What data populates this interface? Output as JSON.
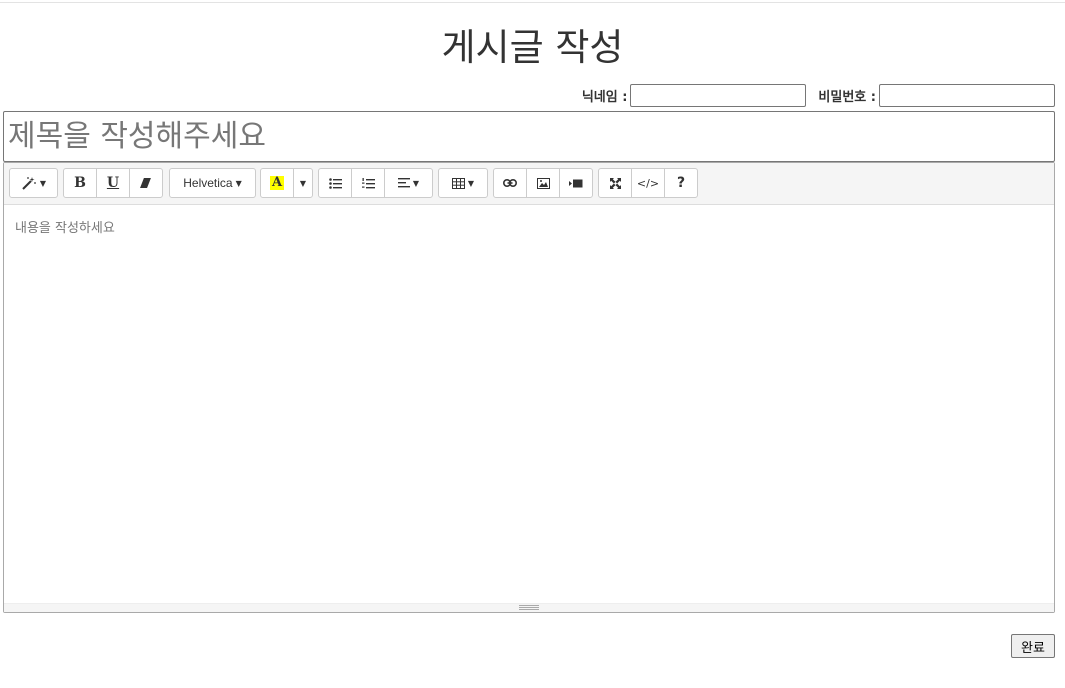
{
  "page": {
    "title": "게시글 작성"
  },
  "meta": {
    "nickname_label": "닉네임 :",
    "nickname_value": "",
    "password_label": "비밀번호 :",
    "password_value": ""
  },
  "title_field": {
    "placeholder": "제목을 작성해주세요",
    "value": ""
  },
  "toolbar": {
    "style_icon": "magic-wand-icon",
    "bold_label": "B",
    "underline_label": "U",
    "eraser_icon": "eraser-icon",
    "font_family": "Helvetica",
    "color_label": "A",
    "color_highlight": "#ffff00",
    "ul_icon": "unordered-list-icon",
    "ol_icon": "ordered-list-icon",
    "align_icon": "align-left-icon",
    "table_icon": "table-icon",
    "link_icon": "link-icon",
    "image_icon": "image-icon",
    "video_icon": "video-icon",
    "fullscreen_icon": "fullscreen-icon",
    "codeview_label": "</>",
    "help_label": "?"
  },
  "editor": {
    "placeholder": "내용을 작성하세요"
  },
  "submit": {
    "label": "완료"
  }
}
